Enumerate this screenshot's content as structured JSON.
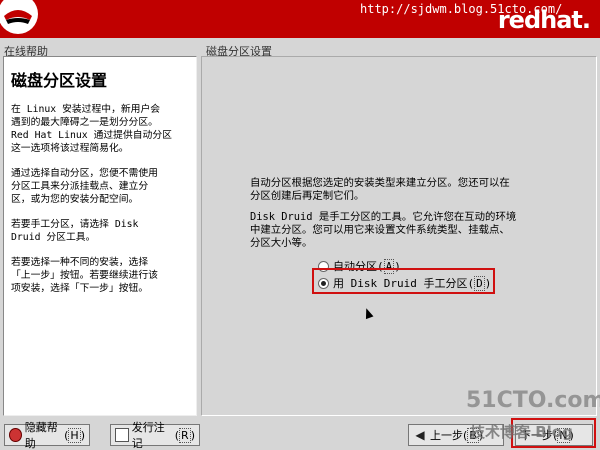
{
  "banner": {
    "watermark_url": "http://sjdwm.blog.51cto.com/",
    "brand": "redhat."
  },
  "help": {
    "panel_title": "在线帮助",
    "heading": "磁盘分区设置",
    "paragraphs": [
      "在 Linux 安装过程中，新用户会\n遇到的最大障碍之一是划分分区。\nRed Hat Linux 通过提供自动分区\n这一选项将该过程简易化。",
      "通过选择自动分区，您便不需使用\n分区工具来分派挂载点、建立分\n区，或为您的安装分配空间。",
      "若要手工分区，请选择 Disk\nDruid 分区工具。",
      "若要选择一种不同的安装，选择\n「上一步」按钮。若要继续进行该\n项安装，选择「下一步」按钮。"
    ]
  },
  "main": {
    "panel_title": "磁盘分区设置",
    "para1": "自动分区根据您选定的安装类型来建立分区。您还可以在\n分区创建后再定制它们。",
    "para2": "Disk Druid 是手工分区的工具。它允许您在互动的环境\n中建立分区。您可以用它来设置文件系统类型、挂载点、\n分区大小等。",
    "option_auto": {
      "label": "自动分区",
      "hotkey": "A",
      "selected": false
    },
    "option_manual": {
      "label": "用 Disk Druid 手工分区",
      "hotkey": "D",
      "selected": true
    }
  },
  "buttons": {
    "hide_help": {
      "label": "隐藏帮助",
      "hotkey": "H"
    },
    "release_notes": {
      "label": "发行注记",
      "hotkey": "R"
    },
    "back": {
      "label": "上一步",
      "hotkey": "B"
    },
    "next": {
      "label": "下一步",
      "hotkey": "N"
    }
  },
  "watermarks": {
    "site": "51CTO.com",
    "blog": "技术博客  Blog"
  },
  "colors": {
    "banner": "#c00000",
    "highlight": "#d01010"
  }
}
